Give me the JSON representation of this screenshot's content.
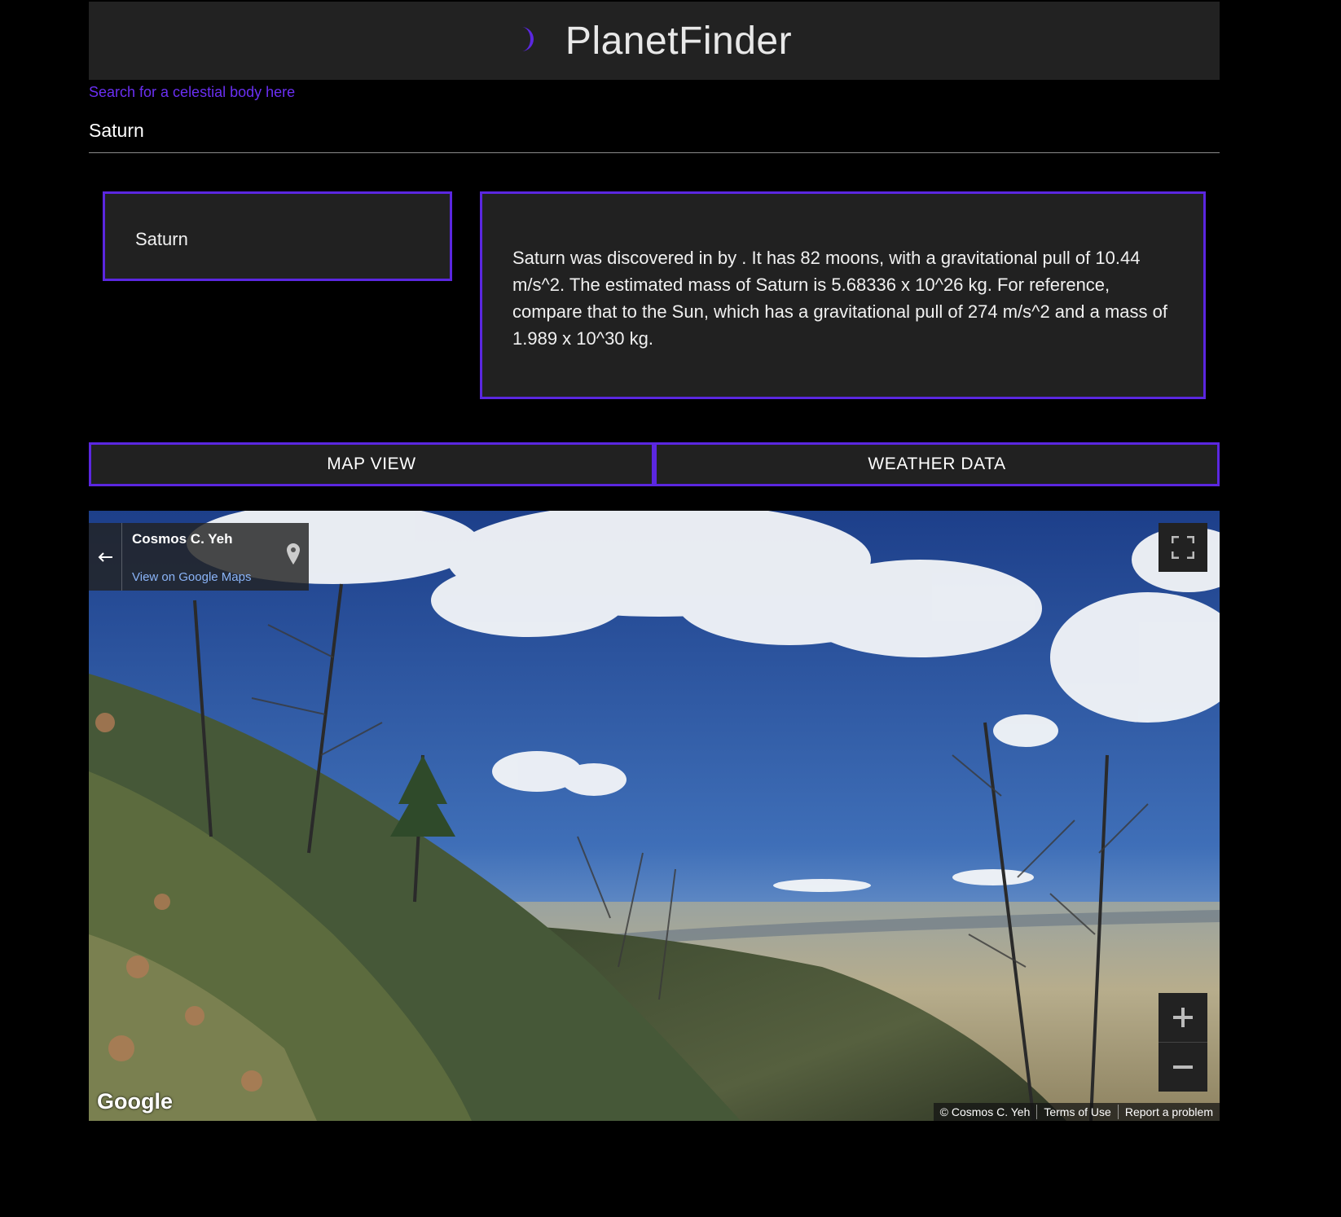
{
  "header": {
    "title": "PlanetFinder",
    "icon": "moon-icon",
    "icon_color": "#5b27e0"
  },
  "search": {
    "label": "Search for a celestial body here",
    "value": "Saturn"
  },
  "planet": {
    "name": "Saturn",
    "description": "Saturn was discovered in by . It has 82 moons, with a gravitational pull of 10.44 m/s^2. The estimated mass of Saturn is 5.68336 x 10^26 kg. For reference, compare that to the Sun, which has a gravitational pull of 274 m/s^2 and a mass of 1.989 x 10^30 kg."
  },
  "tabs": {
    "map_view": "MAP VIEW",
    "weather_data": "WEATHER DATA"
  },
  "streetview": {
    "place_name": "Cosmos C. Yeh",
    "view_link": "View on Google Maps",
    "logo": "Google",
    "copyright": "© Cosmos C. Yeh",
    "terms": "Terms of Use",
    "report": "Report a problem"
  },
  "colors": {
    "accent": "#5b27e0",
    "background": "#000000",
    "panel": "#212121",
    "link": "#6a2ff2"
  }
}
